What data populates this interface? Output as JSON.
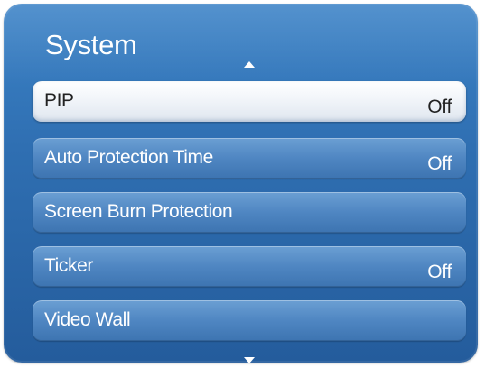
{
  "menu": {
    "title": "System",
    "items": [
      {
        "label": "PIP",
        "value": "Off"
      },
      {
        "label": "Auto Protection Time",
        "value": "Off"
      },
      {
        "label": "Screen Burn Protection",
        "value": ""
      },
      {
        "label": "Ticker",
        "value": "Off"
      },
      {
        "label": "Video Wall",
        "value": ""
      }
    ]
  },
  "icons": {
    "scroll_up": "caret-up-icon",
    "scroll_down": "caret-down-icon"
  },
  "colors": {
    "panel": "#2f6fb2",
    "item": "#4f86c2",
    "selected_item": "#f3f6fa",
    "text": "#ffffff",
    "selected_text": "#222222"
  }
}
